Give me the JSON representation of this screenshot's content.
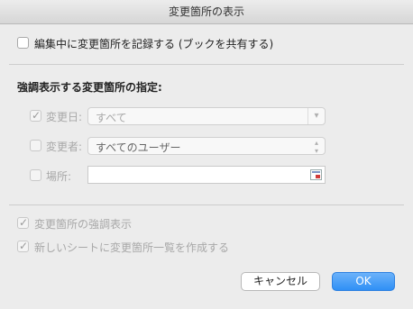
{
  "window": {
    "title": "変更箇所の表示"
  },
  "track": {
    "label": "編集中に変更箇所を記録する (ブックを共有する)",
    "checked": false
  },
  "highlight_section": {
    "heading": "強調表示する変更箇所の指定:"
  },
  "when": {
    "label": "変更日:",
    "checked": true,
    "value": "すべて"
  },
  "who": {
    "label": "変更者:",
    "checked": false,
    "value": "すべてのユーザー"
  },
  "where": {
    "label": "場所:",
    "checked": false,
    "value": ""
  },
  "show_on_screen": {
    "label": "変更箇所の強調表示",
    "checked": true
  },
  "list_on_sheet": {
    "label": "新しいシートに変更箇所一覧を作成する",
    "checked": true
  },
  "buttons": {
    "cancel": "キャンセル",
    "ok": "OK"
  }
}
